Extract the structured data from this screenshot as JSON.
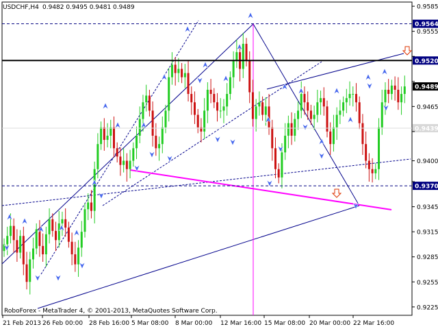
{
  "header": {
    "symbol_timeframe": "USDCHF,H4",
    "ohlc": "0.9482 0.9495 0.9481 0.9489"
  },
  "footer": {
    "copyright": "RoboForex - MetaTrader 4, © 2001-2013, MetaQuotes Software Corp."
  },
  "colors": {
    "background": "#ffffff",
    "bull_candle": "#22cc22",
    "bear_candle": "#cc1111",
    "trend_line": "#00008b",
    "projection_line": "#ff00ff",
    "fractal_arrow": "#4466ee",
    "level_label_bg": "#000080",
    "signal_arrow": "#dd3300"
  },
  "chart_data": {
    "type": "candlestick",
    "title": "USDCHF,H4",
    "ylim": [
      0.9215,
      0.959
    ],
    "y_ticks": [
      "0.9585",
      "0.9555",
      "0.9525",
      "0.9495",
      "0.9465",
      "0.9435",
      "0.9400",
      "0.9375",
      "0.9345",
      "0.9315",
      "0.9285",
      "0.9255",
      "0.9225"
    ],
    "y_tick_values": [
      0.9585,
      0.9555,
      0.9525,
      0.9495,
      0.9465,
      0.9435,
      0.94,
      0.9375,
      0.9345,
      0.9315,
      0.9285,
      0.9255,
      0.9225
    ],
    "x_ticks": [
      "21 Feb 2013",
      "26 Feb 00:00",
      "28 Feb 16:00",
      "5 Mar 08:00",
      "8 Mar 00:00",
      "12 Mar 16:00",
      "15 Mar 08:00",
      "20 Mar 00:00",
      "22 Mar 16:00"
    ],
    "current_price": 0.9489,
    "horizontal_levels": [
      {
        "label": "0.9564",
        "value": 0.9564,
        "style": "dashed"
      },
      {
        "label": "0.9520",
        "value": 0.952,
        "style": "solid"
      },
      {
        "label": "0.9489",
        "value": 0.9489,
        "style": "current"
      },
      {
        "label": "0.9439",
        "value": 0.9439,
        "style": "faded"
      },
      {
        "label": "0.9370",
        "value": 0.937,
        "style": "dashed"
      }
    ],
    "closes": [
      0.93,
      0.931,
      0.9322,
      0.9305,
      0.929,
      0.931,
      0.9276,
      0.9255,
      0.9282,
      0.9295,
      0.9318,
      0.9298,
      0.9288,
      0.9312,
      0.933,
      0.9316,
      0.9305,
      0.9325,
      0.933,
      0.932,
      0.9303,
      0.9288,
      0.9276,
      0.9296,
      0.9315,
      0.9342,
      0.935,
      0.934,
      0.939,
      0.942,
      0.944,
      0.9425,
      0.943,
      0.944,
      0.9415,
      0.9405,
      0.9395,
      0.94,
      0.939,
      0.94,
      0.9415,
      0.943,
      0.945,
      0.947,
      0.9478,
      0.946,
      0.943,
      0.9415,
      0.942,
      0.944,
      0.946,
      0.95,
      0.9515,
      0.9505,
      0.951,
      0.95,
      0.9505,
      0.948,
      0.947,
      0.9455,
      0.944,
      0.9435,
      0.946,
      0.9485,
      0.948,
      0.947,
      0.946,
      0.946,
      0.9465,
      0.948,
      0.95,
      0.952,
      0.953,
      0.951,
      0.954,
      0.952,
      0.9482,
      0.945,
      0.9465,
      0.947,
      0.9455,
      0.9465,
      0.944,
      0.9415,
      0.939,
      0.938,
      0.941,
      0.943,
      0.9445,
      0.943,
      0.945,
      0.946,
      0.948,
      0.947,
      0.946,
      0.945,
      0.9455,
      0.947,
      0.9475,
      0.9465,
      0.9435,
      0.942,
      0.944,
      0.9455,
      0.946,
      0.947,
      0.9475,
      0.948,
      0.948,
      0.947,
      0.9445,
      0.942,
      0.94,
      0.939,
      0.9385,
      0.939,
      0.944,
      0.947,
      0.9485,
      0.948,
      0.949,
      0.9485,
      0.947,
      0.948,
      0.9489
    ]
  }
}
